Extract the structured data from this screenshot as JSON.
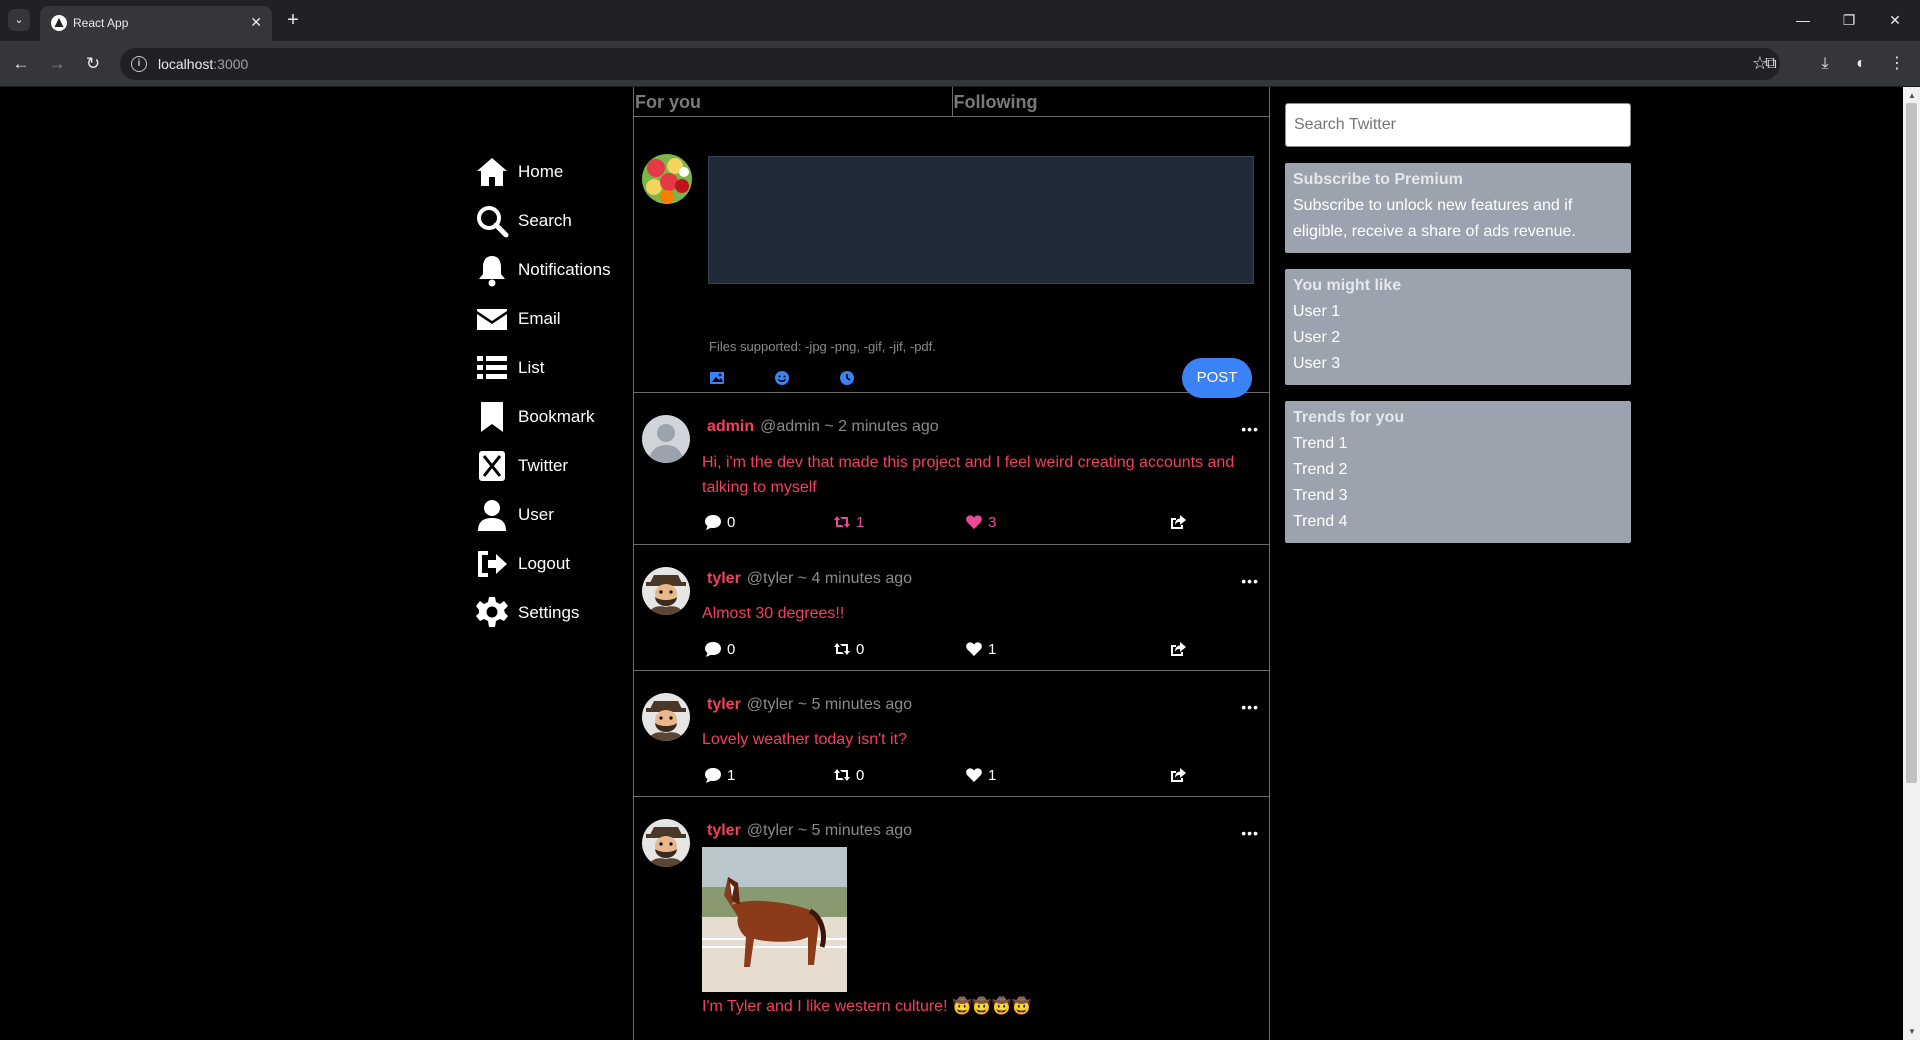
{
  "browser": {
    "tab_title": "React App",
    "url_host": "localhost",
    "url_port": ":3000"
  },
  "nav": {
    "items": [
      {
        "label": "Home",
        "icon": "home-icon"
      },
      {
        "label": "Search",
        "icon": "search-icon"
      },
      {
        "label": "Notifications",
        "icon": "bell-icon"
      },
      {
        "label": "Email",
        "icon": "envelope-icon"
      },
      {
        "label": "List",
        "icon": "list-icon"
      },
      {
        "label": "Bookmark",
        "icon": "bookmark-icon"
      },
      {
        "label": "Twitter",
        "icon": "x-logo-icon"
      },
      {
        "label": "User",
        "icon": "user-icon"
      },
      {
        "label": "Logout",
        "icon": "logout-icon"
      },
      {
        "label": "Settings",
        "icon": "gear-icon"
      }
    ]
  },
  "feed": {
    "tabs": [
      "For you",
      "Following"
    ],
    "compose": {
      "textarea_value": "",
      "files_supported": "Files supported: -jpg -png, -gif, -jif, -pdf.",
      "post_label": "POST"
    },
    "posts": [
      {
        "name": "admin",
        "meta": "@admin ~ 2 minutes ago",
        "text": "Hi, i'm the dev that made this project and I feel weird creating accounts and talking to myself",
        "comments": "0",
        "retweets": "1",
        "likes": "3",
        "retweeted": true,
        "liked": true
      },
      {
        "name": "tyler",
        "meta": "@tyler ~ 4 minutes ago",
        "text": "Almost 30 degrees!!",
        "comments": "0",
        "retweets": "0",
        "likes": "1",
        "retweeted": false,
        "liked": false
      },
      {
        "name": "tyler",
        "meta": "@tyler ~ 5 minutes ago",
        "text": "Lovely weather today isn't it?",
        "comments": "1",
        "retweets": "0",
        "likes": "1",
        "retweeted": false,
        "liked": false
      },
      {
        "name": "tyler",
        "meta": "@tyler ~ 5 minutes ago",
        "text": "I'm Tyler and I like western culture! 🤠🤠🤠🤠",
        "has_image": true
      }
    ]
  },
  "sidebar": {
    "search_placeholder": "Search Twitter",
    "premium": {
      "title": "Subscribe to Premium",
      "text": "Subscribe to unlock new features and if eligible, receive a share of ads revenue."
    },
    "might_like": {
      "title": "You might like",
      "items": [
        "User 1",
        "User 2",
        "User 3"
      ]
    },
    "trends": {
      "title": "Trends for you",
      "items": [
        "Trend 1",
        "Trend 2",
        "Trend 3",
        "Trend 4"
      ]
    }
  },
  "colors": {
    "accent_red": "#f43f5e",
    "accent_pink": "#ec4899",
    "post_button": "#3b82f6",
    "panel_bg": "#9ca3af"
  }
}
